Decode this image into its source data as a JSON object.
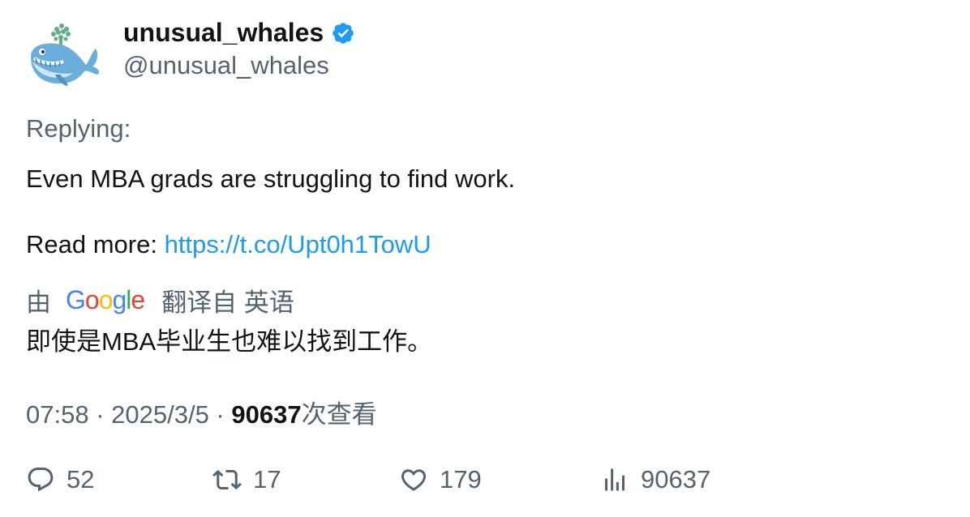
{
  "author": {
    "display_name": "unusual_whales",
    "handle": "@unusual_whales",
    "avatar_icon": "whale-avatar-icon",
    "verified_icon": "verified-badge-icon",
    "verified_color": "#1d9bf0"
  },
  "tweet": {
    "replying_label": "Replying:",
    "text_line1": "Even MBA grads are struggling to find work.",
    "read_more_label": "Read more: ",
    "link_text": "https://t.co/Upt0h1TowU"
  },
  "translation": {
    "prefix": "由",
    "google_letters": [
      "G",
      "o",
      "o",
      "g",
      "l",
      "e"
    ],
    "google_colors": [
      "#4285F4",
      "#EA4335",
      "#FBBC05",
      "#4285F4",
      "#34A853",
      "#EA4335"
    ],
    "suffix": "翻译自 英语",
    "translated_text": "即使是MBA毕业生也难以找到工作。"
  },
  "meta": {
    "time": "07:58",
    "separator": " · ",
    "date": "2025/3/5",
    "views_count": "90637",
    "views_label": "次查看"
  },
  "actions": {
    "replies": "52",
    "retweets": "17",
    "likes": "179",
    "views": "90637"
  },
  "colors": {
    "text_primary": "#0f1419",
    "text_secondary": "#536471",
    "link": "#1d9bf0"
  }
}
